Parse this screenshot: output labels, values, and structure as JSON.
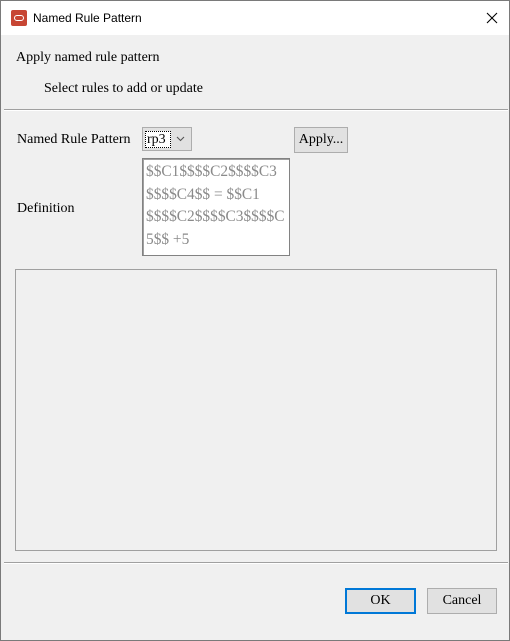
{
  "window": {
    "title": "Named Rule Pattern",
    "accent_color": "#c74634"
  },
  "header": {
    "title": "Apply named rule pattern",
    "subtitle": "Select rules to add or update"
  },
  "form": {
    "pattern_label": "Named Rule Pattern",
    "pattern_value": "rp3",
    "apply_label": "Apply...",
    "definition_label": "Definition",
    "definition_value": "$$C1$$$$C2$$$$C3$$$$C4$$ = $$C1$$$$C2$$$$C3$$$$C5$$ +5"
  },
  "footer": {
    "ok_label": "OK",
    "cancel_label": "Cancel"
  }
}
